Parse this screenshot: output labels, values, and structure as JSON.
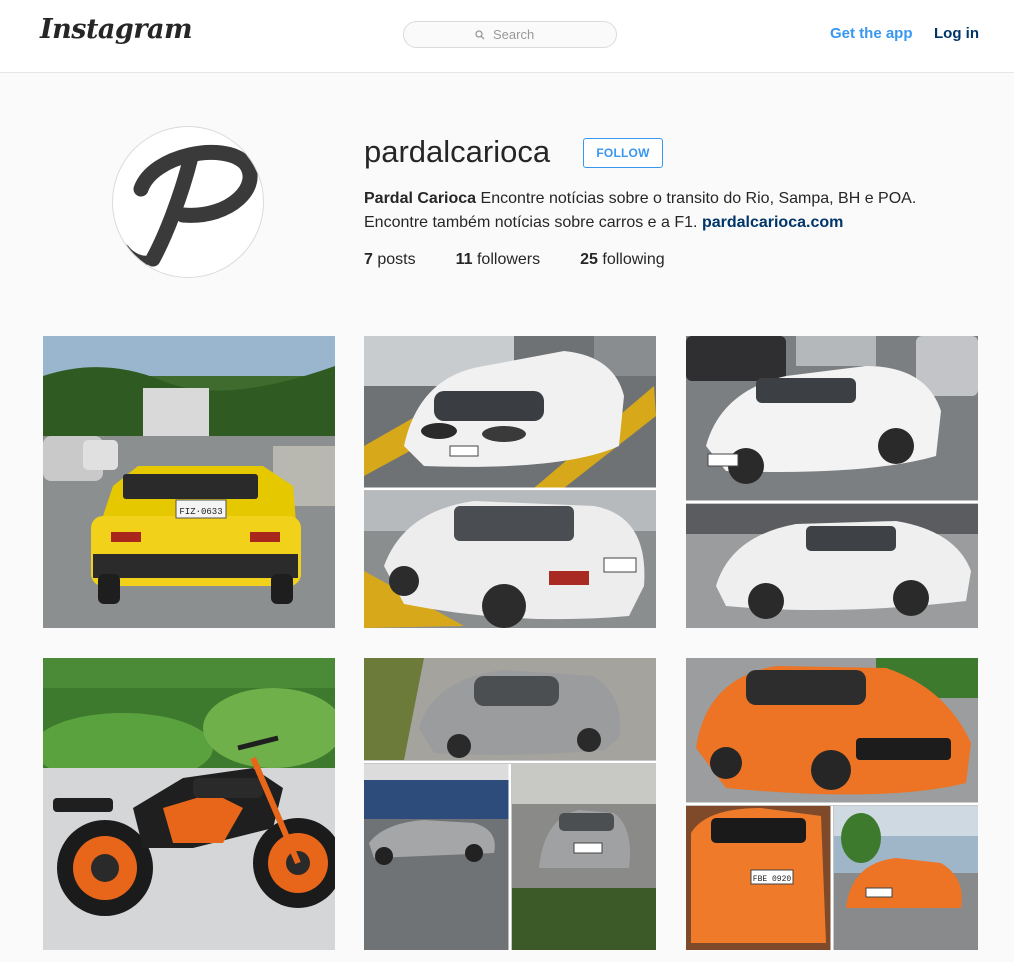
{
  "nav": {
    "logo": "Instagram",
    "search_placeholder": "Search",
    "get_app": "Get the app",
    "login": "Log in"
  },
  "profile": {
    "username": "pardalcarioca",
    "follow_label": "FOLLOW",
    "full_name": "Pardal Carioca",
    "bio_line1": "Encontre notícias sobre o transito do Rio, Sampa, BH e POA.",
    "bio_line2": "Encontre também notícias sobre carros e a F1.",
    "website": "pardalcarioca.com",
    "stats": {
      "posts_count": "7",
      "posts_label": "posts",
      "followers_count": "11",
      "followers_label": "followers",
      "following_count": "25",
      "following_label": "following"
    }
  },
  "posts": [
    {
      "plate": "FIZ·0633"
    },
    {
      "plate": ""
    },
    {
      "plate": ""
    },
    {
      "plate": ""
    },
    {
      "plate": ""
    },
    {
      "plate": "FBE 0920"
    }
  ],
  "colors": {
    "accent": "#3897f0",
    "link_dark": "#003569",
    "background": "#fafafa"
  }
}
